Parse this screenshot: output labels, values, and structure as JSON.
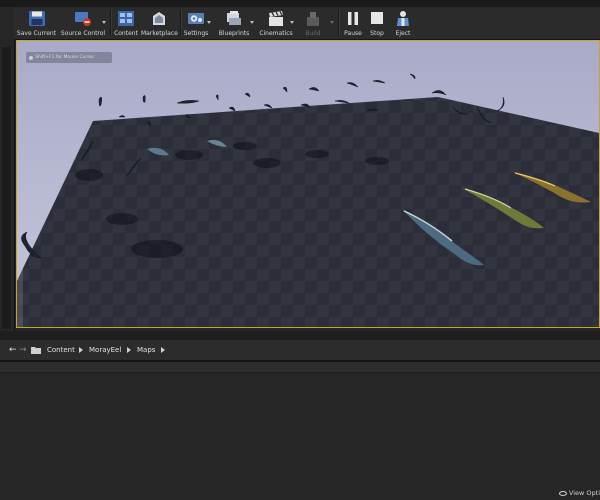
{
  "toolbar": {
    "save_current": "Save Current",
    "source_control": "Source Control",
    "content": "Content",
    "marketplace": "Marketplace",
    "settings": "Settings",
    "blueprints": "Blueprints",
    "cinematics": "Cinematics",
    "build": "Build",
    "pause": "Pause",
    "stop": "Stop",
    "eject": "Eject"
  },
  "viewport": {
    "hint": "Shift+F1 for Mouse Cursor"
  },
  "path": {
    "items": [
      "Content",
      "MorayEel",
      "Maps"
    ]
  },
  "footer": {
    "view_options": "View Opti"
  },
  "colors": {
    "accent": "#c9a42b",
    "viewport_bg": "#aeaeca"
  }
}
